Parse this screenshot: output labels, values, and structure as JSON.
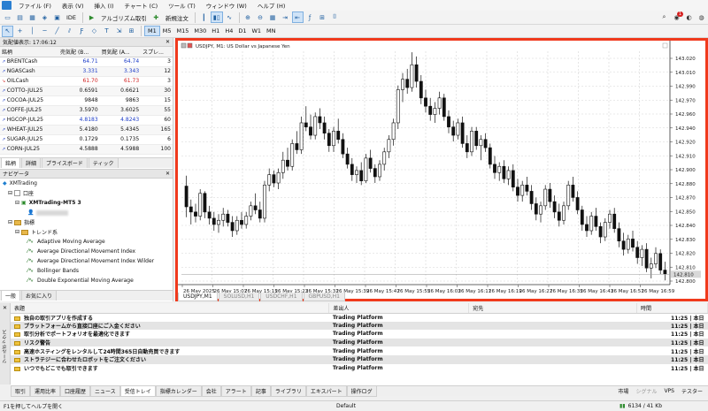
{
  "menu": [
    "ファイル (F)",
    "表示 (V)",
    "挿入 (I)",
    "チャート (C)",
    "ツール (T)",
    "ウィンドウ (W)",
    "ヘルプ (H)"
  ],
  "toolbar": {
    "ide_label": "IDE",
    "algo_label": "アルゴリズム取引",
    "new_order_label": "新規注文",
    "notification_badge": "1",
    "timeframes": [
      "M1",
      "M5",
      "M15",
      "M30",
      "H1",
      "H4",
      "D1",
      "W1",
      "MN"
    ],
    "active_timeframe": "M1"
  },
  "market_watch": {
    "title": "気配値表示: 17:06:12",
    "columns": [
      "銘柄",
      "売気配 (B...",
      "買気配 (A...",
      "スプレ..."
    ],
    "rows": [
      {
        "symbol": "BRENTCash",
        "bid": "64.71",
        "ask": "64.74",
        "spread": "3",
        "color": "#1c3cc7"
      },
      {
        "symbol": "NGASCash",
        "bid": "3.331",
        "ask": "3.343",
        "spread": "12",
        "color": "#1c3cc7"
      },
      {
        "symbol": "OILCash",
        "bid": "61.70",
        "ask": "61.73",
        "spread": "3",
        "color": "#d11e1e"
      },
      {
        "symbol": "COTTO-JUL25",
        "bid": "0.6591",
        "ask": "0.6621",
        "spread": "30",
        "color": "#111111"
      },
      {
        "symbol": "COCOA-JUL25",
        "bid": "9848",
        "ask": "9863",
        "spread": "15",
        "color": "#111111"
      },
      {
        "symbol": "COFFE-JUL25",
        "bid": "3.5970",
        "ask": "3.6025",
        "spread": "55",
        "color": "#111111"
      },
      {
        "symbol": "HGCOP-JUL25",
        "bid": "4.8183",
        "ask": "4.8243",
        "spread": "60",
        "color": "#1c3cc7"
      },
      {
        "symbol": "WHEAT-JUL25",
        "bid": "5.4180",
        "ask": "5.4345",
        "spread": "165",
        "color": "#111111"
      },
      {
        "symbol": "SUGAR-JUL25",
        "bid": "0.1729",
        "ask": "0.1735",
        "spread": "6",
        "color": "#111111"
      },
      {
        "symbol": "CORN-JUL25",
        "bid": "4.5888",
        "ask": "4.5988",
        "spread": "100",
        "color": "#111111"
      }
    ],
    "tabs": [
      "銘柄",
      "詳細",
      "プライスボード",
      "ティック"
    ]
  },
  "navigator": {
    "title": "ナビゲータ",
    "broker": "XMTrading",
    "accounts_label": "口座",
    "account_name": "XMTrading-MT5 3",
    "indicators_label": "指標",
    "trend_label": "トレンド系",
    "indicators": [
      "Adaptive Moving Average",
      "Average Directional Movement Index",
      "Average Directional Movement Index Wilder",
      "Bollinger Bands",
      "Double Exponential Moving Average"
    ],
    "tabs": [
      "一般",
      "お気に入り"
    ]
  },
  "chart": {
    "title": "USDJPY, M1:  US Dollar vs Japanese Yen",
    "tabs": [
      "USDJPY,M1",
      "SOLUSD,H1",
      "USDCHF,H1",
      "GBPUSD,H1"
    ],
    "price_labels": [
      "143.020",
      "143.010",
      "142.990",
      "142.970",
      "142.960",
      "142.940",
      "142.920",
      "142.910",
      "142.900",
      "142.880",
      "142.870",
      "142.850",
      "142.840",
      "142.830",
      "142.820",
      "142.810",
      "142.800"
    ],
    "time_labels": [
      "26 May 2025",
      "26 May 15:07",
      "26 May 15:15",
      "26 May 15:23",
      "26 May 15:31",
      "26 May 15:39",
      "26 May 15:47",
      "26 May 15:55",
      "26 May 16:03",
      "26 May 16:11",
      "26 May 16:19",
      "26 May 16:27",
      "26 May 16:35",
      "26 May 16:43",
      "26 May 16:51",
      "26 May 16:59"
    ],
    "current_price": "142.810",
    "bull_color": "#ffffff",
    "bear_color": "#111111"
  },
  "chart_data": {
    "type": "candlestick",
    "symbol": "USDJPY",
    "timeframe": "M1",
    "ylim": [
      142.8,
      143.025
    ],
    "candles": [
      [
        142.895,
        142.905,
        142.865,
        142.875
      ],
      [
        142.875,
        142.882,
        142.858,
        142.87
      ],
      [
        142.87,
        142.878,
        142.86,
        142.866
      ],
      [
        142.866,
        142.892,
        142.862,
        142.888
      ],
      [
        142.888,
        142.89,
        142.864,
        142.87
      ],
      [
        142.87,
        142.876,
        142.858,
        142.864
      ],
      [
        142.864,
        142.87,
        142.852,
        142.858
      ],
      [
        142.858,
        142.868,
        142.85,
        142.862
      ],
      [
        142.862,
        142.874,
        142.856,
        142.868
      ],
      [
        142.868,
        142.872,
        142.856,
        142.86
      ],
      [
        142.86,
        142.866,
        142.846,
        142.852
      ],
      [
        142.852,
        142.866,
        142.848,
        142.862
      ],
      [
        142.862,
        142.87,
        142.854,
        142.858
      ],
      [
        142.858,
        142.87,
        142.854,
        142.866
      ],
      [
        142.866,
        142.88,
        142.862,
        142.876
      ],
      [
        142.876,
        142.888,
        142.868,
        142.872
      ],
      [
        142.872,
        142.88,
        142.86,
        142.864
      ],
      [
        142.864,
        142.9,
        142.86,
        142.896
      ],
      [
        142.896,
        142.912,
        142.89,
        142.906
      ],
      [
        142.906,
        142.91,
        142.894,
        142.898
      ],
      [
        142.898,
        142.912,
        142.892,
        142.908
      ],
      [
        142.908,
        142.928,
        142.902,
        142.92
      ],
      [
        142.92,
        142.932,
        142.91,
        142.914
      ],
      [
        142.914,
        142.94,
        142.91,
        142.936
      ],
      [
        142.936,
        142.948,
        142.926,
        142.93
      ],
      [
        142.93,
        142.962,
        142.926,
        142.956
      ],
      [
        142.956,
        142.972,
        142.948,
        142.952
      ],
      [
        142.952,
        142.964,
        142.94,
        142.944
      ],
      [
        142.944,
        142.966,
        142.94,
        142.962
      ],
      [
        142.962,
        142.97,
        142.95,
        142.956
      ],
      [
        142.956,
        142.962,
        142.94,
        142.946
      ],
      [
        142.946,
        142.95,
        142.928,
        142.934
      ],
      [
        142.934,
        142.952,
        142.928,
        142.948
      ],
      [
        142.948,
        142.96,
        142.936,
        142.94
      ],
      [
        142.94,
        142.946,
        142.922,
        142.926
      ],
      [
        142.926,
        142.932,
        142.912,
        142.916
      ],
      [
        142.916,
        142.922,
        142.9,
        142.906
      ],
      [
        142.906,
        142.914,
        142.898,
        142.91
      ],
      [
        142.91,
        142.918,
        142.896,
        142.9
      ],
      [
        142.9,
        142.926,
        142.898,
        142.922
      ],
      [
        142.922,
        142.93,
        142.908,
        142.912
      ],
      [
        142.912,
        142.916,
        142.898,
        142.904
      ],
      [
        142.904,
        142.92,
        142.9,
        142.916
      ],
      [
        142.916,
        142.932,
        142.91,
        142.928
      ],
      [
        142.928,
        142.944,
        142.922,
        142.94
      ],
      [
        142.94,
        142.96,
        142.934,
        142.956
      ],
      [
        142.956,
        142.992,
        142.95,
        142.988
      ],
      [
        142.988,
        143.004,
        142.976,
        142.998
      ],
      [
        142.998,
        143.008,
        142.984,
        142.99
      ],
      [
        142.99,
        143.024,
        142.986,
        143.012
      ],
      [
        143.012,
        143.02,
        142.99,
        142.996
      ],
      [
        142.996,
        143.002,
        142.974,
        142.98
      ],
      [
        142.98,
        142.988,
        142.966,
        142.972
      ],
      [
        142.972,
        142.98,
        142.958,
        142.964
      ],
      [
        142.964,
        142.976,
        142.956,
        142.97
      ],
      [
        142.97,
        142.986,
        142.964,
        142.98
      ],
      [
        142.98,
        142.984,
        142.958,
        142.962
      ],
      [
        142.962,
        142.968,
        142.946,
        142.952
      ],
      [
        142.952,
        142.958,
        142.938,
        142.944
      ],
      [
        142.944,
        142.96,
        142.94,
        142.956
      ],
      [
        142.956,
        142.962,
        142.932,
        142.936
      ],
      [
        142.936,
        142.944,
        142.922,
        142.928
      ],
      [
        142.928,
        142.952,
        142.924,
        142.948
      ],
      [
        142.948,
        142.952,
        142.93,
        142.934
      ],
      [
        142.934,
        142.944,
        142.92,
        142.94
      ],
      [
        142.94,
        142.946,
        142.928,
        142.932
      ],
      [
        142.932,
        142.936,
        142.912,
        142.916
      ],
      [
        142.916,
        142.924,
        142.902,
        142.908
      ],
      [
        142.908,
        142.918,
        142.9,
        142.914
      ],
      [
        142.914,
        142.92,
        142.898,
        142.902
      ],
      [
        142.902,
        142.914,
        142.896,
        142.91
      ],
      [
        142.91,
        142.916,
        142.89,
        142.894
      ],
      [
        142.894,
        142.902,
        142.88,
        142.886
      ],
      [
        142.886,
        142.9,
        142.88,
        142.896
      ],
      [
        142.896,
        142.904,
        142.886,
        142.89
      ],
      [
        142.89,
        142.896,
        142.872,
        142.878
      ],
      [
        142.878,
        142.884,
        142.862,
        142.868
      ],
      [
        142.868,
        142.88,
        142.86,
        142.876
      ],
      [
        142.876,
        142.896,
        142.872,
        142.892
      ],
      [
        142.892,
        142.898,
        142.874,
        142.88
      ],
      [
        142.88,
        142.886,
        142.864,
        142.87
      ],
      [
        142.87,
        142.878,
        142.856,
        142.862
      ],
      [
        142.862,
        142.88,
        142.858,
        142.876
      ],
      [
        142.876,
        142.9,
        142.872,
        142.896
      ],
      [
        142.896,
        142.904,
        142.88,
        142.884
      ],
      [
        142.884,
        142.89,
        142.868,
        142.872
      ],
      [
        142.872,
        142.876,
        142.852,
        142.858
      ],
      [
        142.858,
        142.866,
        142.846,
        142.852
      ],
      [
        142.852,
        142.87,
        142.848,
        142.866
      ],
      [
        142.866,
        142.874,
        142.852,
        142.856
      ],
      [
        142.856,
        142.86,
        142.84,
        142.846
      ],
      [
        142.846,
        142.864,
        142.842,
        142.86
      ],
      [
        142.86,
        142.872,
        142.854,
        142.868
      ],
      [
        142.868,
        142.874,
        142.85,
        142.854
      ],
      [
        142.854,
        142.86,
        142.836,
        142.842
      ],
      [
        142.842,
        142.85,
        142.828,
        142.834
      ],
      [
        142.834,
        142.848,
        142.83,
        142.844
      ],
      [
        142.844,
        142.852,
        142.832,
        142.836
      ],
      [
        142.836,
        142.842,
        142.82,
        142.826
      ],
      [
        142.826,
        142.838,
        142.818,
        142.834
      ],
      [
        142.834,
        142.84,
        142.812,
        142.816
      ],
      [
        142.816,
        142.826,
        142.806,
        142.82
      ],
      [
        142.82,
        142.836,
        142.816,
        142.83
      ],
      [
        142.83,
        142.834,
        142.81,
        142.814
      ],
      [
        142.814,
        142.822,
        142.804,
        142.81
      ]
    ]
  },
  "toolbox": {
    "side_label": "ツールボックス",
    "columns": [
      "表題",
      "差出人",
      "宛先",
      "時間"
    ],
    "rows": [
      {
        "title": "独自の取引アプリを作成する",
        "from": "Trading Platform",
        "to": "",
        "time": "11:25 | 本日"
      },
      {
        "title": "プラットフォームから直接口座にご入金ください",
        "from": "Trading Platform",
        "to": "",
        "time": "11:25 | 本日"
      },
      {
        "title": "取引分析でポートフォリオを最適化できます",
        "from": "Trading Platform",
        "to": "",
        "time": "11:25 | 本日"
      },
      {
        "title": "リスク警告",
        "from": "Trading Platform",
        "to": "",
        "time": "11:25 | 本日"
      },
      {
        "title": "高速ホスティングをレンタルして24時間365日自動売買できます",
        "from": "Trading Platform",
        "to": "",
        "time": "11:25 | 本日"
      },
      {
        "title": "ストラテジーに合わせたロボットをご注文ください",
        "from": "Trading Platform",
        "to": "",
        "time": "11:25 | 本日"
      },
      {
        "title": "いつでもどこでも取引できます",
        "from": "Trading Platform",
        "to": "",
        "time": "11:25 | 本日"
      }
    ],
    "tabs": [
      "取引",
      "運用比率",
      "口座履歴",
      "ニュース",
      "受信トレイ",
      "指標カレンダー",
      "会社",
      "アラート",
      "記事",
      "ライブラリ",
      "エキスパート",
      "操作ログ"
    ],
    "active_tab": "受信トレイ",
    "right_items": [
      "市場",
      "シグナル",
      "VPS",
      "テスター"
    ]
  },
  "status": {
    "help": "F1を押してヘルプを開く",
    "profile": "Default",
    "traffic": "6134 / 41 Kb"
  }
}
